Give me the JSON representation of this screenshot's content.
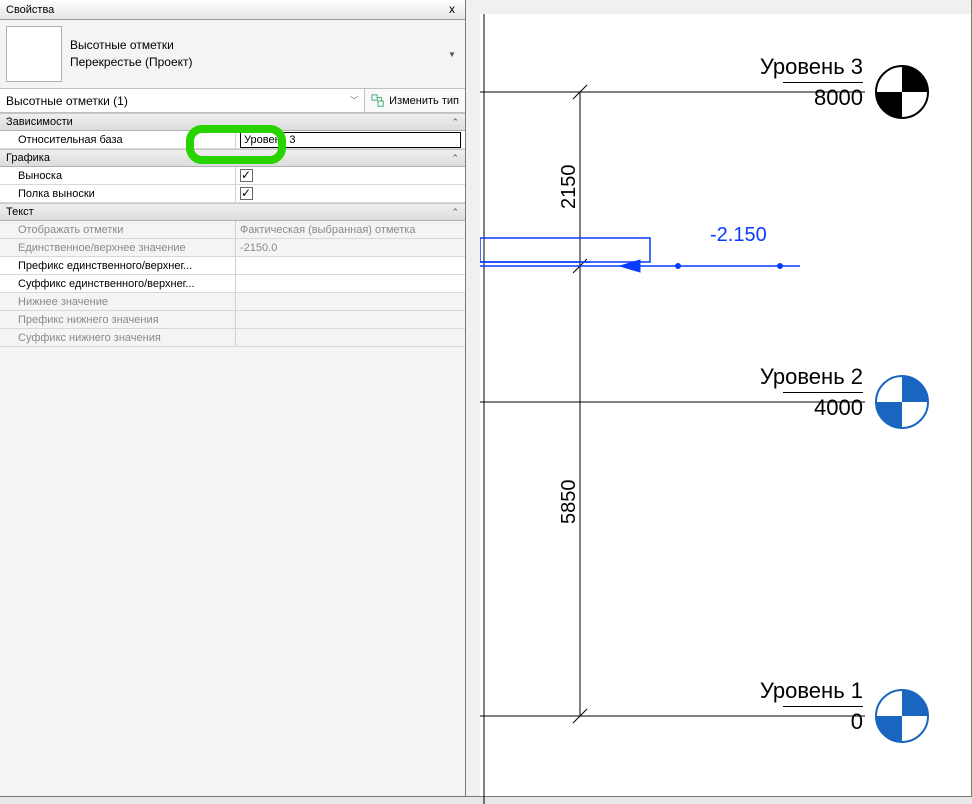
{
  "panel": {
    "title": "Свойства",
    "close_label": "x",
    "family_name": "Высотные отметки",
    "type_name": "Перекрестье (Проект)",
    "filter_text": "Высотные отметки (1)",
    "edit_type_label": "Изменить тип"
  },
  "groups": {
    "g1": {
      "title": "Зависимости",
      "rows": {
        "rel_base": {
          "label": "Относительная база",
          "value": "Уровень 3"
        }
      }
    },
    "g2": {
      "title": "Графика",
      "rows": {
        "leader": {
          "label": "Выноска"
        },
        "shelf": {
          "label": "Полка выноски"
        }
      }
    },
    "g3": {
      "title": "Текст",
      "rows": {
        "display": {
          "label": "Отображать отметки",
          "value": "Фактическая (выбранная) отметка"
        },
        "single_top": {
          "label": "Единственное/верхнее значение",
          "value": "-2150.0"
        },
        "prefix_top": {
          "label": "Префикс единственного/верхнег...",
          "value": ""
        },
        "suffix_top": {
          "label": "Суффикс единственного/верхнег...",
          "value": ""
        },
        "lower": {
          "label": "Нижнее значение",
          "value": ""
        },
        "prefix_low": {
          "label": "Префикс нижнего значения",
          "value": ""
        },
        "suffix_low": {
          "label": "Суффикс нижнего значения",
          "value": ""
        }
      }
    }
  },
  "canvas": {
    "levels": [
      {
        "name": "Уровень 3",
        "elev": "8000"
      },
      {
        "name": "Уровень 2",
        "elev": "4000"
      },
      {
        "name": "Уровень 1",
        "elev": "0"
      }
    ],
    "dims": {
      "d1": "2150",
      "d2": "5850"
    },
    "spot_elev": "-2.150"
  },
  "colors": {
    "selection_blue": "#0a3cff",
    "highlight_green": "#28d400"
  }
}
